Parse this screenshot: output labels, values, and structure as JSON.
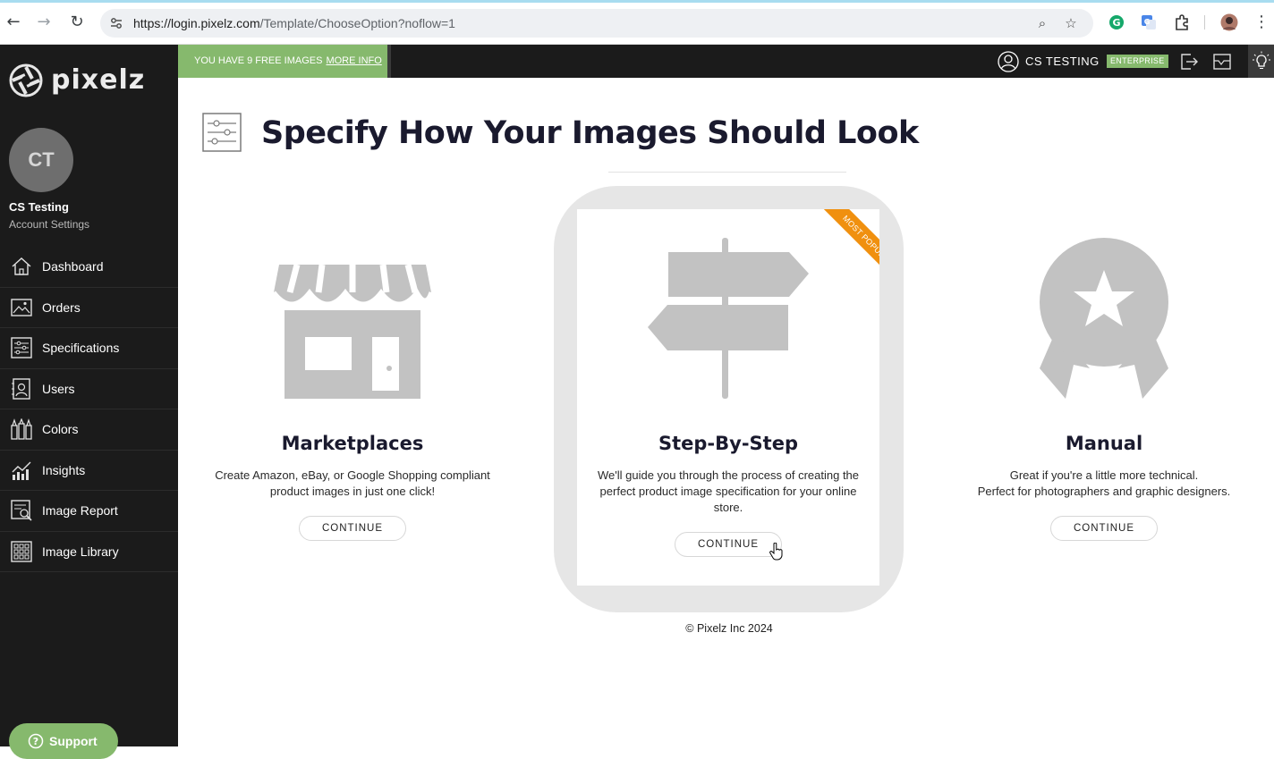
{
  "browser": {
    "url_host": "https://login.pixelz.com",
    "url_path": "/Template/ChooseOption?noflow=1"
  },
  "sidebar": {
    "logo_text": "pixelz",
    "avatar_initials": "CT",
    "user_name": "CS Testing",
    "account_settings": "Account Settings",
    "items": [
      {
        "label": "Dashboard",
        "icon": "home-icon"
      },
      {
        "label": "Orders",
        "icon": "image-icon"
      },
      {
        "label": "Specifications",
        "icon": "sliders-icon"
      },
      {
        "label": "Users",
        "icon": "users-icon"
      },
      {
        "label": "Colors",
        "icon": "paint-tubes-icon"
      },
      {
        "label": "Insights",
        "icon": "chart-icon"
      },
      {
        "label": "Image Report",
        "icon": "report-icon"
      },
      {
        "label": "Image Library",
        "icon": "grid-icon"
      }
    ],
    "support_label": "Support"
  },
  "topbar": {
    "free_images_text": "YOU HAVE 9 FREE IMAGES",
    "more_info": "MORE INFO",
    "user_label": "CS TESTING",
    "plan_badge": "ENTERPRISE"
  },
  "main": {
    "page_title": "Specify How Your Images Should Look",
    "options": [
      {
        "title": "Marketplaces",
        "description": [
          "Create Amazon, eBay, or Google Shopping compliant",
          "product images in just one click!"
        ],
        "button": "CONTINUE"
      },
      {
        "title": "Step-By-Step",
        "description": [
          "We'll guide you through the process of creating the",
          "perfect product image specification for your online",
          "store."
        ],
        "button": "CONTINUE",
        "ribbon": "MOST POPULAR"
      },
      {
        "title": "Manual",
        "description": [
          "Great if you're a little more technical.",
          "Perfect for photographers and graphic designers."
        ],
        "button": "CONTINUE"
      }
    ],
    "footer": "© Pixelz Inc 2024"
  },
  "colors": {
    "sidebar_bg": "#1b1b1b",
    "accent_green": "#86b96d",
    "ribbon_orange": "#f0900f",
    "icon_gray": "#c2c2c2"
  }
}
